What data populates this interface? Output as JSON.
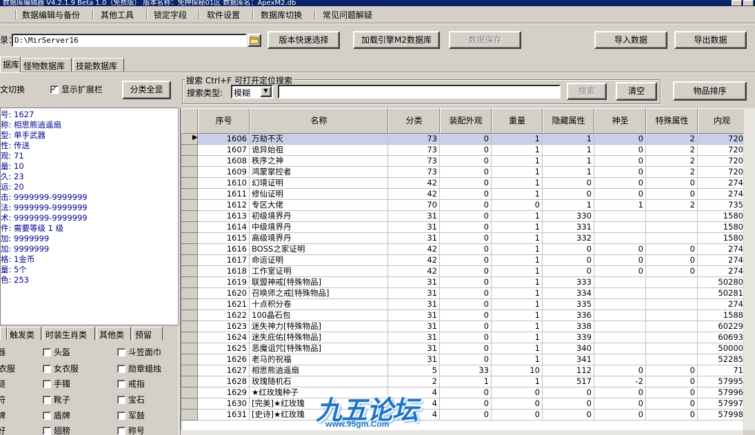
{
  "window": {
    "title": "数据库编辑器 V4.2.1.9    Beta 1.0（免费版）    版本名称：免押探秘01区    数据库名：ApexM2.db"
  },
  "menu": [
    "数据编辑与备份",
    "其他工具",
    "锁定字段",
    "软件设置",
    "数据库切换",
    "常见问题解疑"
  ],
  "path_row": {
    "label": "录：",
    "path_value": "D:\\MirServer16",
    "buttons": {
      "version_select": "版本快速选择",
      "load_m2": "加载引擎M2数据库",
      "save_data": "数据保存",
      "import": "导入数据",
      "export": "导出数据"
    }
  },
  "tabs": [
    "据库",
    "怪物数据库",
    "技能数据库"
  ],
  "search_area": {
    "switch_label": "文切换",
    "show_ext_label": "显示扩展栏",
    "show_ext_checked": true,
    "show_all_button": "分类全显",
    "group_label": "搜索  Ctrl+F 可打开定位搜索",
    "type_label": "搜索类型:",
    "type_value": "模糊",
    "query_value": "",
    "search_button": "搜索",
    "clear_button": "清空",
    "sort_button": "物品排序"
  },
  "info_panel": [
    "号: 1627",
    "称: 相思熊逍遥扇",
    "型: 单手武器",
    "性: 传送",
    "观: 71",
    "量: 10",
    "久: 23",
    "运: 20",
    "击: 9999999-9999999",
    "法: 9999999-9999999",
    "术: 9999999-9999999",
    "件: 需要等级 1 级",
    "加: 9999999",
    "加: 9999999",
    "格: 1金币",
    "量: 5个",
    "色: 253"
  ],
  "lower_tabs": [
    "触发类",
    "时装生肖类",
    "其他类",
    "预留"
  ],
  "category_checkboxes": [
    [
      "器",
      "头盔",
      "斗笠面巾"
    ],
    [
      "衣服",
      "女衣服",
      "勋章蜡烛"
    ],
    [
      "链",
      "手镯",
      "戒指"
    ],
    [
      "符",
      "靴子",
      "宝石"
    ],
    [
      "牌",
      "盾牌",
      "军鼓"
    ],
    [
      "好",
      "翅膀",
      "称号"
    ]
  ],
  "grid": {
    "columns": [
      "序号",
      "名称",
      "分类",
      "装配外观",
      "重量",
      "隐藏属性",
      "神圣",
      "特殊属性",
      "内观"
    ],
    "rows": [
      [
        "1606",
        "万劫不灭",
        "73",
        "0",
        "1",
        "1",
        "0",
        "2",
        "720"
      ],
      [
        "1607",
        "诡异始祖",
        "73",
        "0",
        "1",
        "1",
        "0",
        "2",
        "720"
      ],
      [
        "1608",
        "秩序之神",
        "73",
        "0",
        "1",
        "1",
        "0",
        "2",
        "720"
      ],
      [
        "1609",
        "鸿蒙掌控者",
        "73",
        "0",
        "1",
        "1",
        "0",
        "2",
        "720"
      ],
      [
        "1610",
        "幻境证明",
        "42",
        "0",
        "1",
        "0",
        "0",
        "0",
        "274"
      ],
      [
        "1611",
        "修仙证明",
        "42",
        "0",
        "1",
        "0",
        "0",
        "0",
        "274"
      ],
      [
        "1612",
        "专区大佬",
        "70",
        "0",
        "0",
        "1",
        "1",
        "2",
        "735"
      ],
      [
        "1613",
        "初级境界丹",
        "31",
        "0",
        "1",
        "330",
        "",
        "",
        "1580"
      ],
      [
        "1614",
        "中级境界丹",
        "31",
        "0",
        "1",
        "331",
        "",
        "",
        "1580"
      ],
      [
        "1615",
        "高级境界丹",
        "31",
        "0",
        "1",
        "332",
        "",
        "",
        "1580"
      ],
      [
        "1616",
        "BOSS之家证明",
        "42",
        "0",
        "1",
        "0",
        "0",
        "0",
        "274"
      ],
      [
        "1617",
        "命运证明",
        "42",
        "0",
        "1",
        "0",
        "0",
        "0",
        "274"
      ],
      [
        "1618",
        "工作室证明",
        "42",
        "0",
        "1",
        "0",
        "0",
        "0",
        "274"
      ],
      [
        "1619",
        "联盟神戒[特殊物品]",
        "31",
        "0",
        "1",
        "333",
        "",
        "",
        "50280"
      ],
      [
        "1620",
        "召唤师之戒[特殊物品]",
        "31",
        "0",
        "1",
        "334",
        "",
        "",
        "50281"
      ],
      [
        "1621",
        "十点积分卷",
        "31",
        "0",
        "1",
        "335",
        "",
        "",
        "274"
      ],
      [
        "1622",
        "100晶石包",
        "31",
        "0",
        "1",
        "336",
        "",
        "",
        "1588"
      ],
      [
        "1623",
        "迷失神力[特殊物品]",
        "31",
        "0",
        "1",
        "338",
        "",
        "",
        "60229"
      ],
      [
        "1624",
        "迷失庇佑[特殊物品]",
        "31",
        "0",
        "1",
        "339",
        "",
        "",
        "60693"
      ],
      [
        "1625",
        "恶魔诅咒[特殊物品]",
        "31",
        "0",
        "1",
        "340",
        "",
        "",
        "50000"
      ],
      [
        "1626",
        "老马的祝福",
        "31",
        "0",
        "1",
        "341",
        "",
        "",
        "52285"
      ],
      [
        "1627",
        "相思熊逍遥扇",
        "5",
        "33",
        "10",
        "112",
        "0",
        "0",
        "71"
      ],
      [
        "1628",
        "玫瑰随机石",
        "2",
        "1",
        "1",
        "517",
        "-2",
        "0",
        "57995"
      ],
      [
        "1629",
        "★红玫瑰种子",
        "4",
        "0",
        "0",
        "0",
        "0",
        "0",
        "57996"
      ],
      [
        "1630",
        "[完美]★红玫瑰",
        "4",
        "0",
        "0",
        "0",
        "0",
        "0",
        "57997"
      ],
      [
        "1631",
        "[史诗]★红玫瑰",
        "4",
        "0",
        "0",
        "0",
        "0",
        "0",
        "57998"
      ]
    ]
  },
  "watermark": {
    "text": "九五论坛",
    "url": "www.95gm.Com"
  }
}
